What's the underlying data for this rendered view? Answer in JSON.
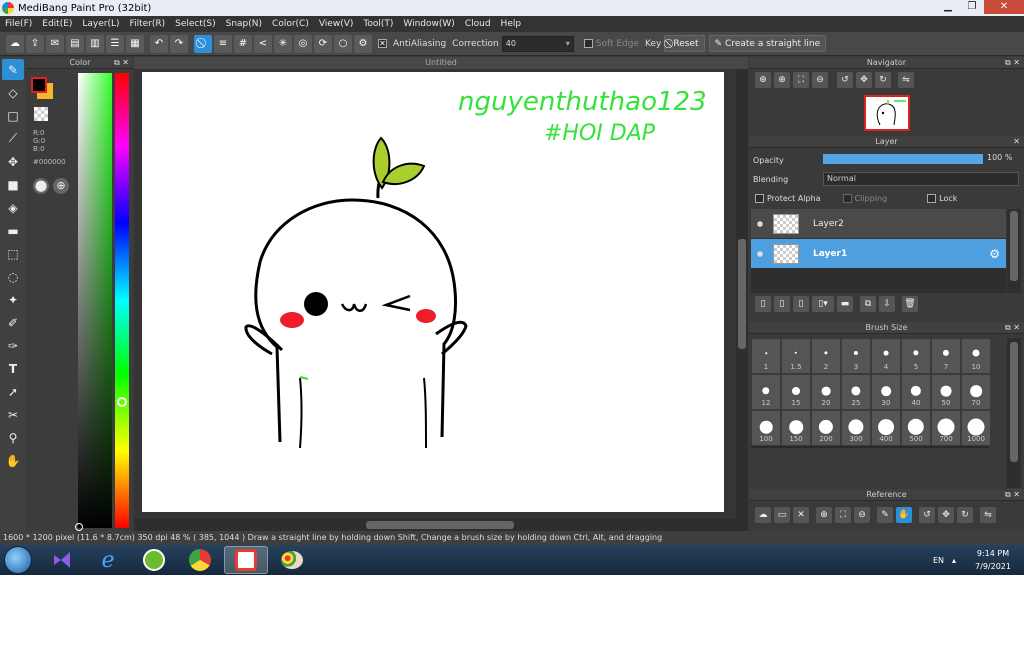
{
  "window": {
    "title": "MediBang Paint Pro (32bit)",
    "minimize": "▁",
    "restore": "❐",
    "close": "✕"
  },
  "menu": [
    "File(F)",
    "Edit(E)",
    "Layer(L)",
    "Filter(R)",
    "Select(S)",
    "Snap(N)",
    "Color(C)",
    "View(V)",
    "Tool(T)",
    "Window(W)",
    "Cloud",
    "Help"
  ],
  "toolbar": {
    "antialiasing_label": "AntiAliasing",
    "correction_label": "Correction",
    "correction_value": "40",
    "soft_edge_label": "Soft Edge",
    "key_label": "Key",
    "reset_label": "Reset",
    "straight_line_label": "Create a straight line"
  },
  "color_panel": {
    "title": "Color",
    "r": "R:0",
    "g": "G:0",
    "b": "B:0",
    "hex": "#000000",
    "fg_color": "#000000",
    "bg_color": "#f7b42c"
  },
  "document": {
    "tab": "Untitled"
  },
  "drawing": {
    "line1": "nguyenthuthao123",
    "line2": "#HOI DAP"
  },
  "navigator": {
    "title": "Navigator"
  },
  "layer_panel": {
    "title": "Layer",
    "opacity_label": "Opacity",
    "opacity_value": "100 %",
    "opacity_fraction": 1.0,
    "blending_label": "Blending",
    "blending_value": "Normal",
    "protect_alpha": "Protect Alpha",
    "clipping": "Clipping",
    "lock": "Lock",
    "layers": [
      {
        "name": "Layer2",
        "selected": false
      },
      {
        "name": "Layer1",
        "selected": true
      }
    ]
  },
  "brush_size": {
    "title": "Brush Size",
    "sizes": [
      "1",
      "1.5",
      "2",
      "3",
      "4",
      "5",
      "7",
      "10",
      "12",
      "15",
      "20",
      "25",
      "30",
      "40",
      "50",
      "70",
      "100",
      "150",
      "200",
      "300",
      "400",
      "500",
      "700",
      "1000"
    ]
  },
  "reference": {
    "title": "Reference"
  },
  "status": {
    "canvas_size": "1600 * 1200 pixel",
    "physical_size": "(11.6 * 8.7cm)",
    "dpi": "350 dpi",
    "zoom": "48 %",
    "cursor": "( 385, 1044 )",
    "hint": "Draw a straight line by holding down Shift, Change a brush size by holding down Ctrl, Alt, and dragging"
  },
  "taskbar": {
    "lang": "EN",
    "time": "9:14 PM",
    "date": "7/9/2021"
  }
}
